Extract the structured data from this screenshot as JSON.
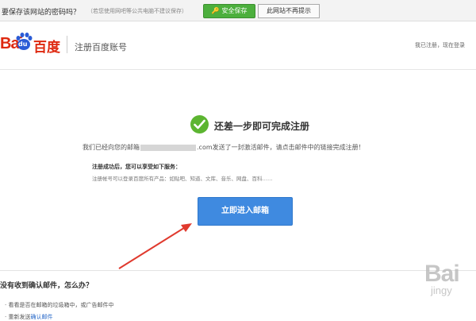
{
  "save_bar": {
    "question": "要保存该网站的密码吗？",
    "hint": "（若您使用网吧等公共电脑不建议保存）",
    "save_button": "安全保存",
    "no_remind_button": "此网站不再提示"
  },
  "header": {
    "logo_latin": "Bai",
    "logo_paw_text": "du",
    "logo_chinese": "百度",
    "page_title": "注册百度账号",
    "login_hint": "我已注册，现在登录"
  },
  "main": {
    "success_title": "还差一步即可完成注册",
    "notice_prefix": "我们已经向您的邮箱",
    "notice_suffix": ".com发送了一封激活邮件，请点击邮件中的链接完成注册！",
    "after_title": "注册成功后，您可以享受如下服务：",
    "after_text": "注册帐号可以登录百度所有产品：如贴吧、知道、文库、音乐、网盘、百科……",
    "enter_button": "立即进入邮箱"
  },
  "faq": {
    "title": "没有收到确认邮件，怎么办？",
    "item1": "看看是否在邮箱的垃圾箱中，或广告邮件中",
    "item2_prefix": "重新发送",
    "item2_link": "确认邮件"
  },
  "watermark": {
    "line1": "Bai",
    "line2": "jingy"
  },
  "colors": {
    "brand_red": "#de2910",
    "success_green": "#5cb531",
    "primary_blue": "#3f8ae0",
    "arrow_red": "#e03a2e"
  }
}
